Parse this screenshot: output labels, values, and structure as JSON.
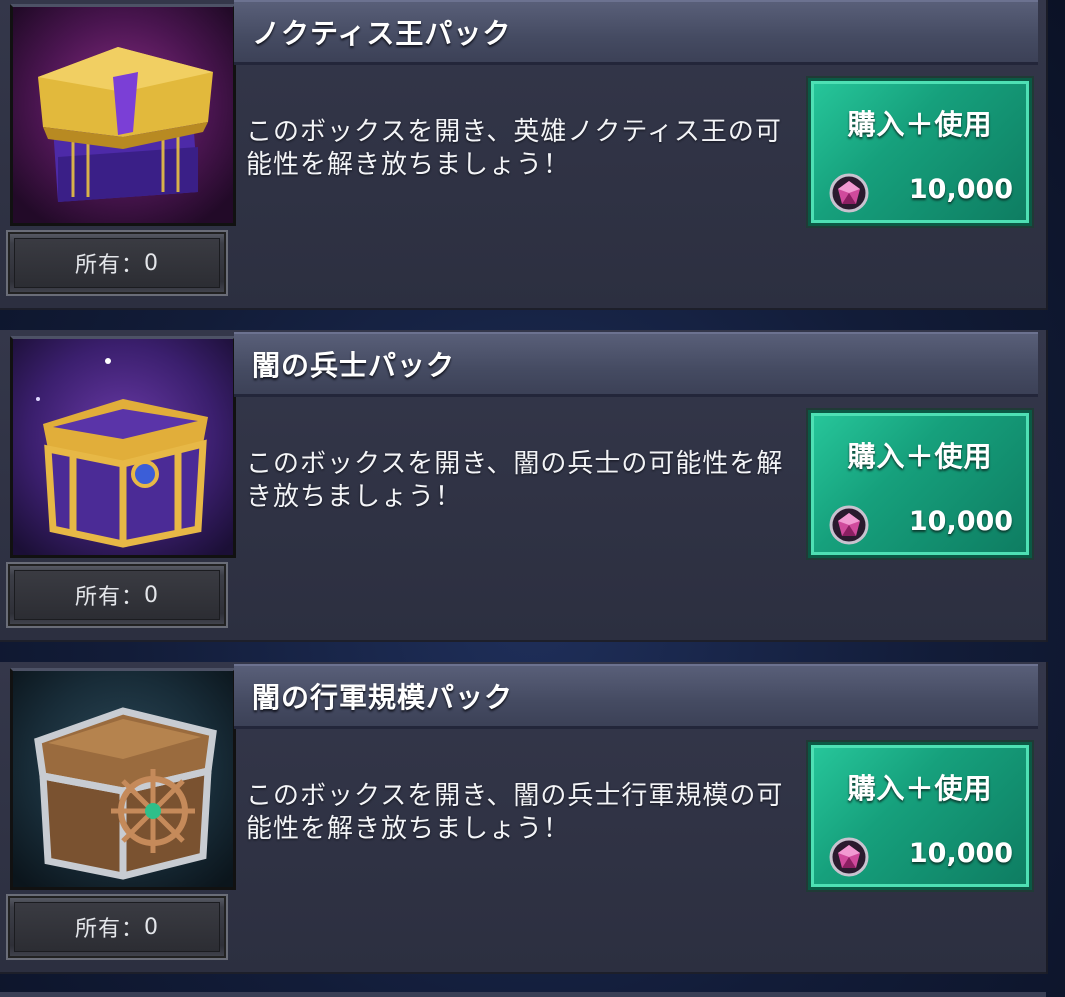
{
  "currency_icon": "gem-icon",
  "accent_color": "#16a07c",
  "packs": [
    {
      "title": "ノクティス王パック",
      "description": "このボックスを開き、英雄ノクティス王の可能性を解き放ちましょう！",
      "owned_label": "所有：",
      "owned_count": "0",
      "buy_label": "購入＋使用",
      "price": "10,000",
      "image_icon": "purple-gold-chest-icon"
    },
    {
      "title": "闇の兵士パック",
      "description": "このボックスを開き、闇の兵士の可能性を解き放ちましょう！",
      "owned_label": "所有：",
      "owned_count": "0",
      "buy_label": "購入＋使用",
      "price": "10,000",
      "image_icon": "gold-frame-chest-icon"
    },
    {
      "title": "闇の行軍規模パック",
      "description": "このボックスを開き、闇の兵士行軍規模の可能性を解き放ちましょう！",
      "owned_label": "所有：",
      "owned_count": "0",
      "buy_label": "購入＋使用",
      "price": "10,000",
      "image_icon": "ship-wheel-chest-icon"
    }
  ]
}
